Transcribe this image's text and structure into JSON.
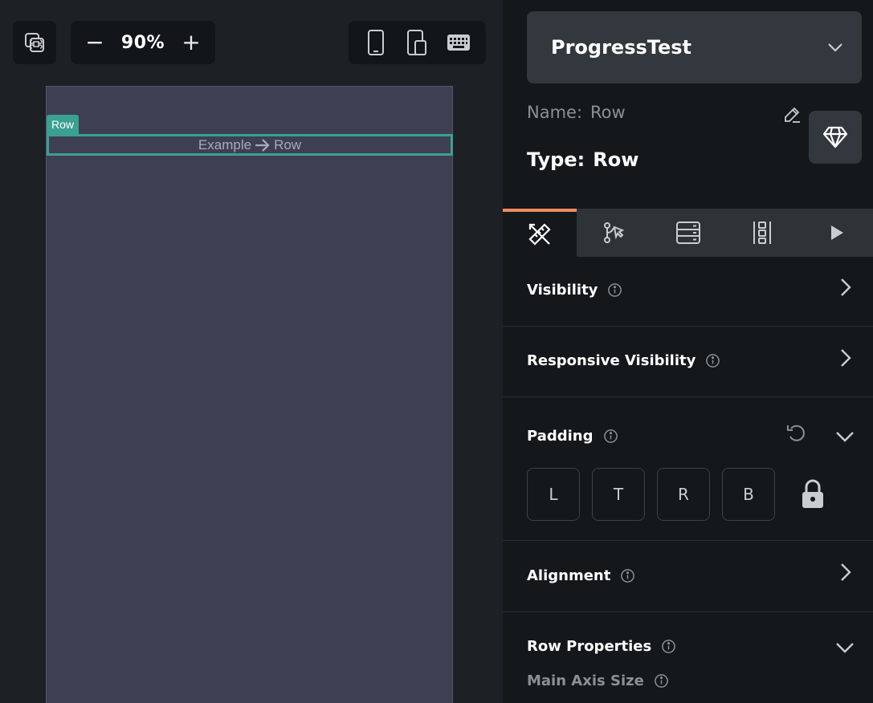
{
  "toolbar": {
    "zoom_minus": "−",
    "zoom_value": "90%",
    "zoom_plus": "+",
    "icons": [
      "command-icon",
      "phone-icon",
      "tablet-icon",
      "keyboard-icon"
    ]
  },
  "canvas": {
    "selected_tag": "Row",
    "row_left": "Example",
    "row_right": "Row"
  },
  "panel": {
    "page_name": "ProgressTest",
    "name_label": "Name:",
    "name_value": "Row",
    "type_label": "Type:",
    "type_value": "Row",
    "tabs": [
      "properties-icon",
      "actions-icon",
      "backend-icon",
      "layout-icon",
      "play-icon"
    ],
    "active_tab_color": "#ee8b60",
    "sections": {
      "visibility": "Visibility",
      "responsive_visibility": "Responsive Visibility",
      "padding": "Padding",
      "alignment": "Alignment",
      "row_properties": "Row Properties",
      "main_axis_size": "Main Axis Size"
    },
    "padding_boxes": [
      "L",
      "T",
      "R",
      "B"
    ]
  },
  "colors": {
    "selection": "#3aa191",
    "accent": "#ee8b60"
  }
}
